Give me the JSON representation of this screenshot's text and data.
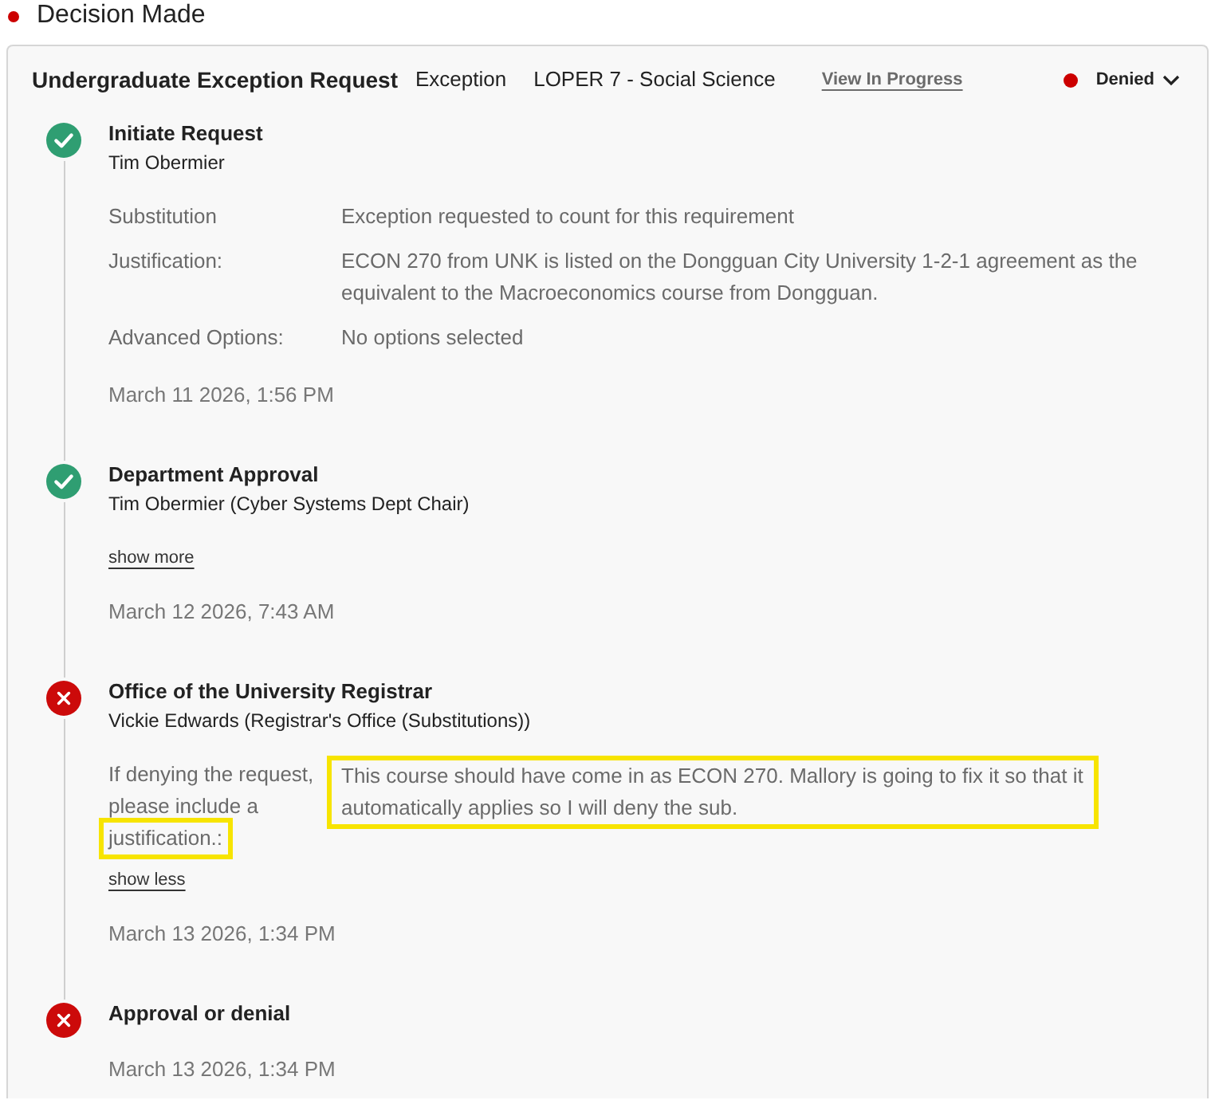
{
  "section": {
    "title": "Decision Made"
  },
  "request": {
    "title": "Undergraduate Exception Request",
    "type": "Exception",
    "requirement": "LOPER 7 - Social Science",
    "link": "View In Progress",
    "status": "Denied",
    "expanded": true
  },
  "steps": [
    {
      "approved": true,
      "title": "Initiate Request",
      "subtitle": "Tim Obermier",
      "fields": [
        {
          "label": "Substitution",
          "value": "Exception requested to count for this requirement",
          "highlighted": false
        },
        {
          "label": "Justification:",
          "value": "ECON 270 from UNK is listed on the Dongguan City University 1-2-1 agreement as the equivalent to the Macroeconomics course from Dongguan.",
          "highlighted": false
        },
        {
          "label": "Advanced Options:",
          "value": "No options selected",
          "highlighted": false
        }
      ],
      "date": "March 11 2026, 1:56 PM"
    },
    {
      "approved": true,
      "title": "Department Approval",
      "subtitle": "Tim Obermier (Cyber Systems Dept Chair)",
      "toggle": "show more",
      "date": "March 12 2026, 7:43 AM"
    },
    {
      "approved": false,
      "title": "Office of the University Registrar",
      "subtitle": "Vickie Edwards (Registrar's Office (Substitutions))",
      "fields": [
        {
          "label": "If denying the request, please include a",
          "label_tail": {
            "text": "justification.:",
            "highlighted": true
          },
          "value": "This course should have come in as ECON 270. Mallory is going to fix it so that it automatically applies so I will deny the sub.",
          "highlighted": true
        }
      ],
      "toggle": "show less",
      "date": "March 13 2026, 1:34 PM"
    },
    {
      "approved": false,
      "title": "Approval or denial",
      "date": "March 13 2026, 1:34 PM"
    }
  ]
}
